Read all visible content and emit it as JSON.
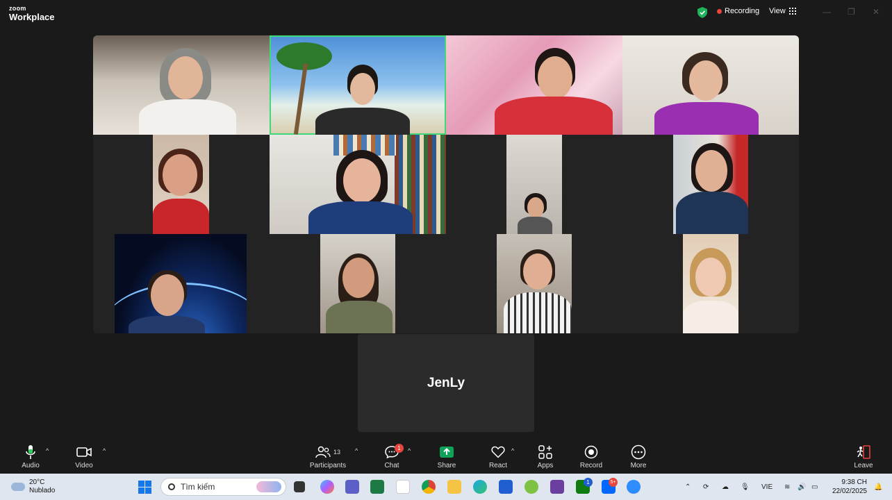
{
  "titlebar": {
    "brand_small": "zoom",
    "brand_large": "Workplace",
    "recording": "Recording",
    "view": "View"
  },
  "gallery": {
    "active_speaker_tile": "tile-2",
    "name_tile": "JenLy"
  },
  "toolbar": {
    "audio": "Audio",
    "video": "Video",
    "participants": "Participants",
    "participants_count": "13",
    "chat": "Chat",
    "chat_badge": "1",
    "share": "Share",
    "react": "React",
    "apps": "Apps",
    "record": "Record",
    "more": "More",
    "leave": "Leave",
    "share_color": "#0fa35a",
    "leave_color": "#e8453c"
  },
  "taskbar": {
    "temperature": "20°C",
    "weather": "Nublado",
    "search_placeholder": "Tìm kiếm",
    "language": "VIE",
    "time": "9:38 CH",
    "date": "22/02/2025",
    "edge_badge": "1",
    "xbox_badge": "1",
    "zalo_badge": "5+"
  }
}
